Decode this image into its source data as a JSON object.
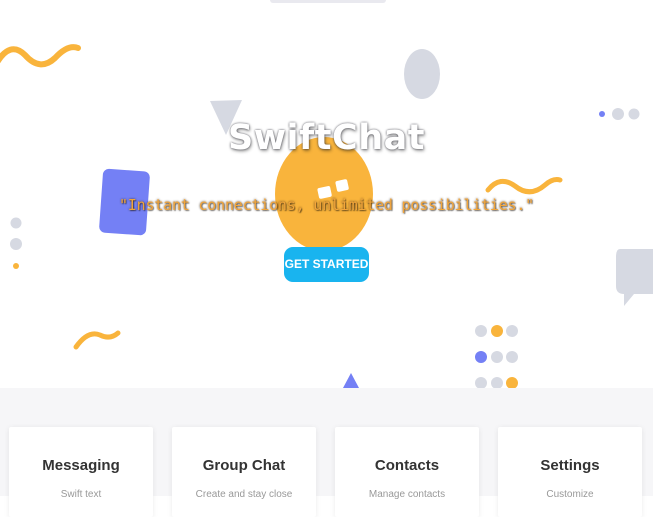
{
  "hero": {
    "brand_title": "SwiftChat",
    "tagline": "\"Instant connections, unlimited possibilities.\"",
    "cta_label": "GET STARTED"
  },
  "features": [
    {
      "title": "Messaging",
      "desc": "Swift text"
    },
    {
      "title": "Group Chat",
      "desc": "Create and stay close"
    },
    {
      "title": "Contacts",
      "desc": "Manage contacts"
    },
    {
      "title": "Settings",
      "desc": "Customize"
    }
  ],
  "colors": {
    "accent": "#19b4ef",
    "yellow": "#f9b43c",
    "purple": "#7480f5",
    "gray": "#d6d9e2",
    "tagline": "#f2a53a"
  }
}
